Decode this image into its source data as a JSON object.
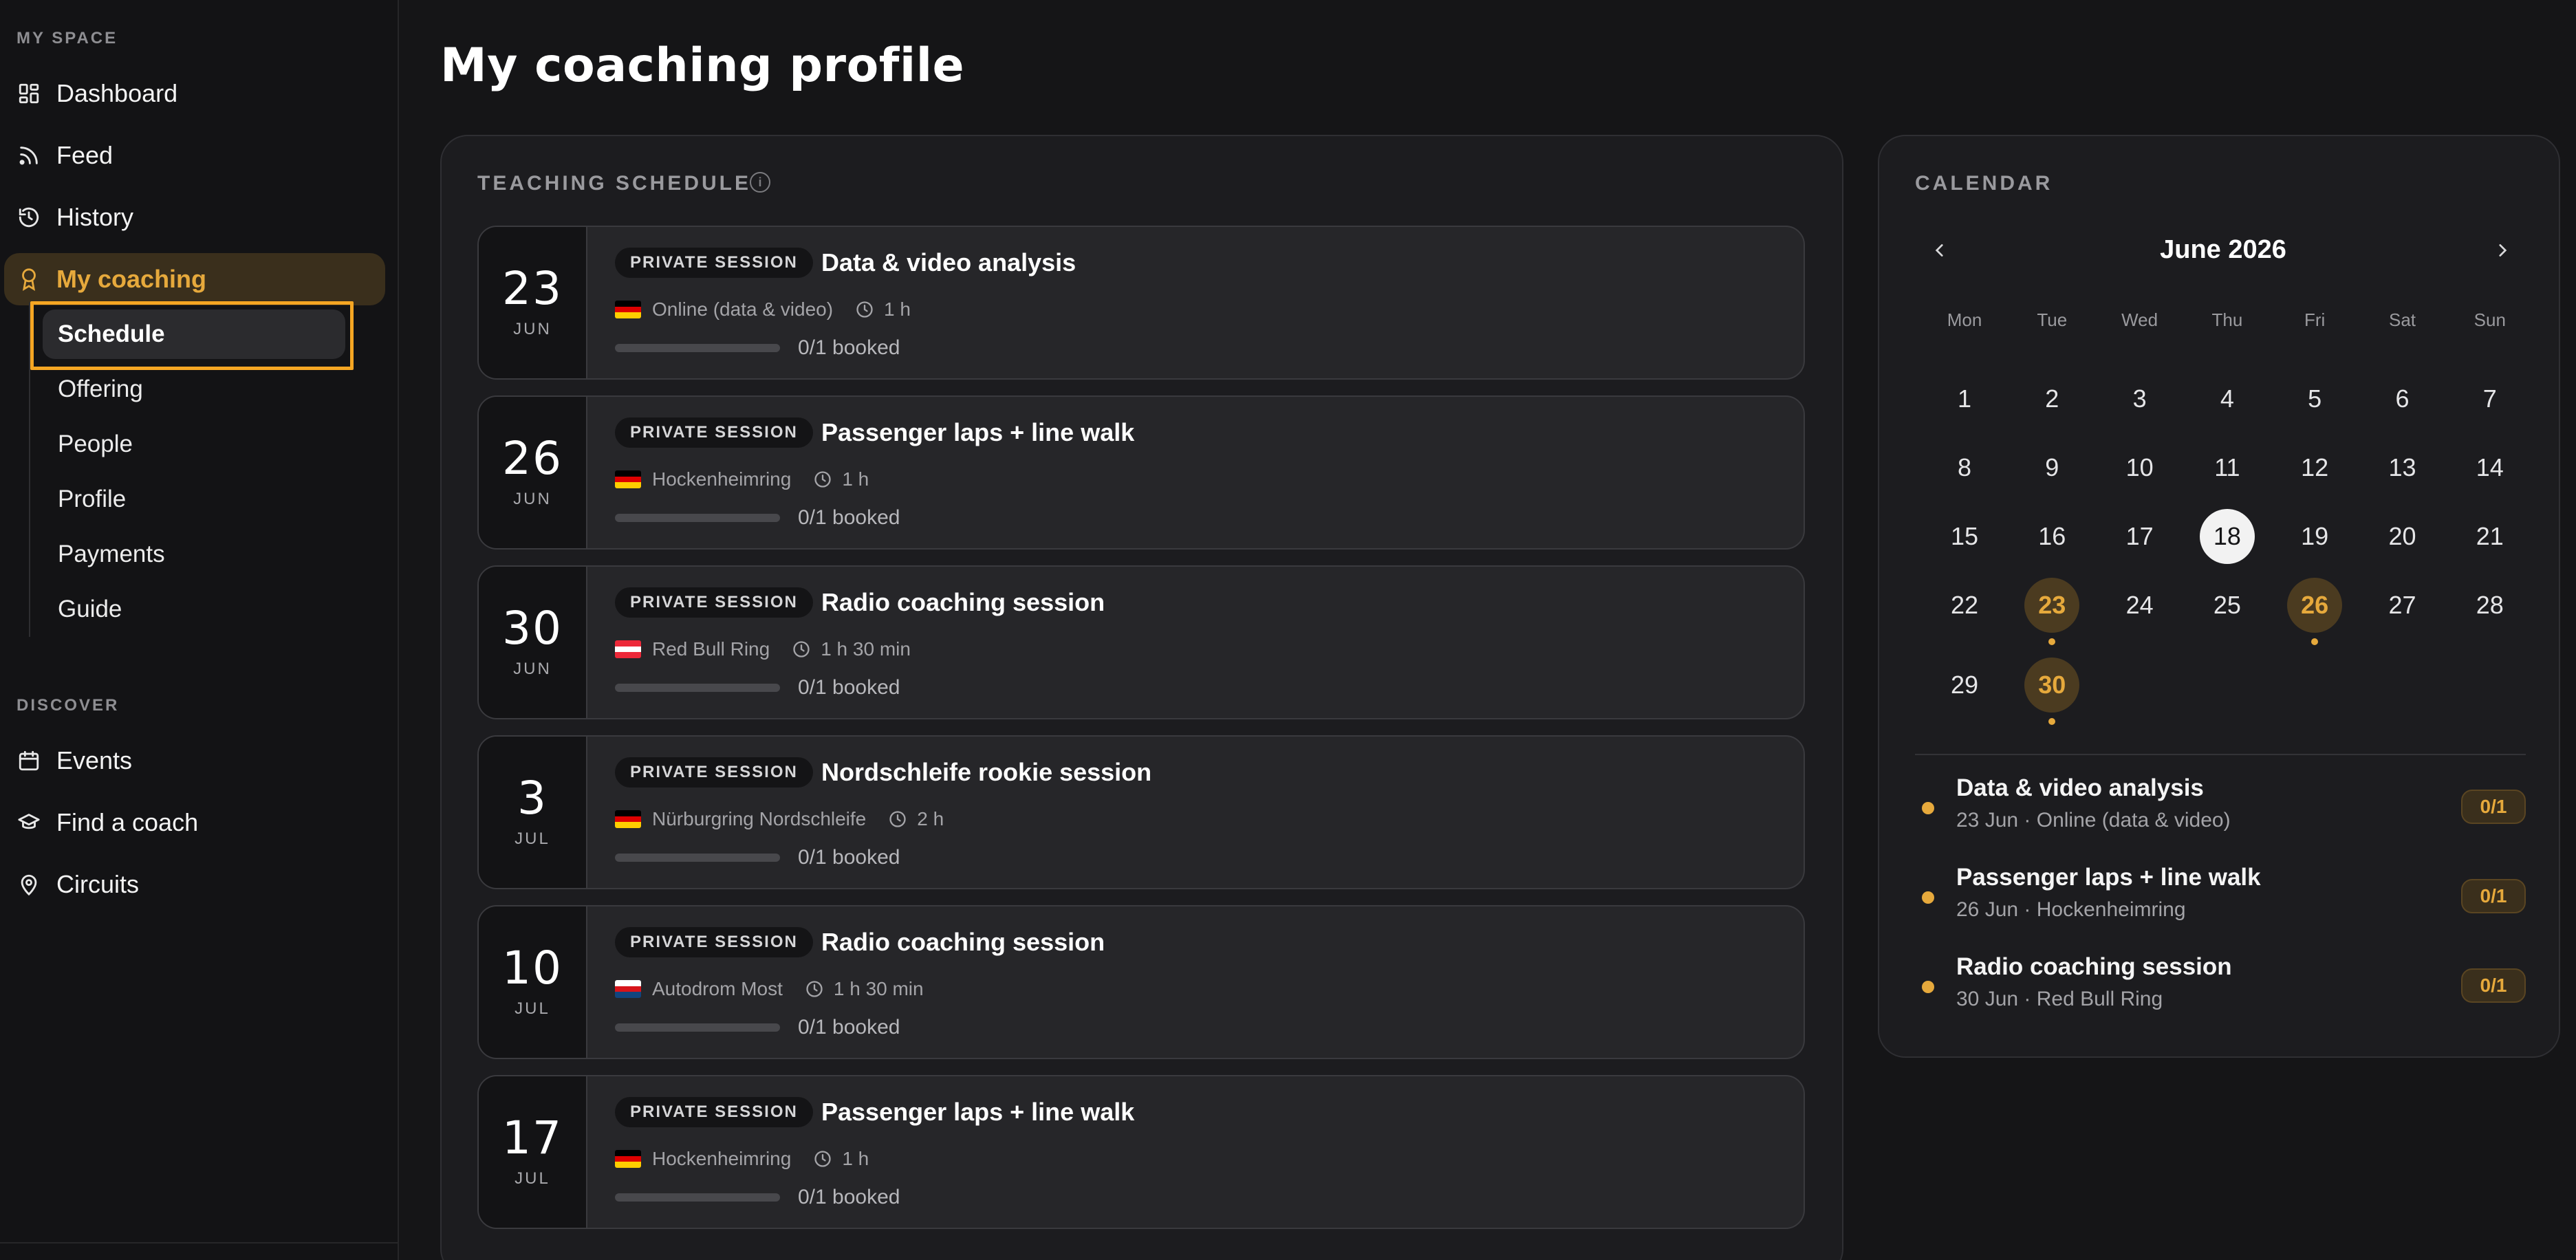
{
  "sidebar": {
    "section_my_space": "MY SPACE",
    "section_discover": "DISCOVER",
    "items": [
      {
        "label": "Dashboard",
        "icon": "grid-icon"
      },
      {
        "label": "Feed",
        "icon": "rss-icon"
      },
      {
        "label": "History",
        "icon": "history-icon"
      },
      {
        "label": "My coaching",
        "icon": "badge-icon"
      }
    ],
    "subitems": [
      {
        "label": "Schedule"
      },
      {
        "label": "Offering"
      },
      {
        "label": "People"
      },
      {
        "label": "Profile"
      },
      {
        "label": "Payments"
      },
      {
        "label": "Guide"
      }
    ],
    "discover_items": [
      {
        "label": "Events",
        "icon": "calendar-icon"
      },
      {
        "label": "Find a coach",
        "icon": "graduation-cap-icon"
      },
      {
        "label": "Circuits",
        "icon": "map-pin-icon"
      }
    ]
  },
  "page": {
    "title": "My coaching profile"
  },
  "schedule": {
    "label": "TEACHING SCHEDULE",
    "sessions": [
      {
        "day": "23",
        "month": "JUN",
        "badge": "PRIVATE SESSION",
        "title": "Data & video analysis",
        "location": "Online (data & video)",
        "duration": "1 h",
        "booked": "0/1 booked",
        "booked_fraction": 0,
        "flag": "de"
      },
      {
        "day": "26",
        "month": "JUN",
        "badge": "PRIVATE SESSION",
        "title": "Passenger laps + line walk",
        "location": "Hockenheimring",
        "duration": "1 h",
        "booked": "0/1 booked",
        "booked_fraction": 0,
        "flag": "de"
      },
      {
        "day": "30",
        "month": "JUN",
        "badge": "PRIVATE SESSION",
        "title": "Radio coaching session",
        "location": "Red Bull Ring",
        "duration": "1 h 30 min",
        "booked": "0/1 booked",
        "booked_fraction": 0,
        "flag": "at"
      },
      {
        "day": "3",
        "month": "JUL",
        "badge": "PRIVATE SESSION",
        "title": "Nordschleife rookie session",
        "location": "Nürburgring Nordschleife",
        "duration": "2 h",
        "booked": "0/1 booked",
        "booked_fraction": 0,
        "flag": "de"
      },
      {
        "day": "10",
        "month": "JUL",
        "badge": "PRIVATE SESSION",
        "title": "Radio coaching session",
        "location": "Autodrom Most",
        "duration": "1 h 30 min",
        "booked": "0/1 booked",
        "booked_fraction": 0,
        "flag": "cz"
      },
      {
        "day": "17",
        "month": "JUL",
        "badge": "PRIVATE SESSION",
        "title": "Passenger laps + line walk",
        "location": "Hockenheimring",
        "duration": "1 h",
        "booked": "0/1 booked",
        "booked_fraction": 0,
        "flag": "de"
      }
    ]
  },
  "calendar": {
    "label": "CALENDAR",
    "month": "June 2026",
    "weekdays": [
      "Mon",
      "Tue",
      "Wed",
      "Thu",
      "Fri",
      "Sat",
      "Sun"
    ],
    "days": [
      "1",
      "2",
      "3",
      "4",
      "5",
      "6",
      "7",
      "8",
      "9",
      "10",
      "11",
      "12",
      "13",
      "14",
      "15",
      "16",
      "17",
      "18",
      "19",
      "20",
      "21",
      "22",
      "23",
      "24",
      "25",
      "26",
      "27",
      "28",
      "29",
      "30"
    ],
    "today": "18",
    "event_days": [
      "23",
      "26",
      "30"
    ],
    "upcoming": [
      {
        "title": "Data & video analysis",
        "sub": "23 Jun · Online (data & video)",
        "badge": "0/1"
      },
      {
        "title": "Passenger laps + line walk",
        "sub": "26 Jun · Hockenheimring",
        "badge": "0/1"
      },
      {
        "title": "Radio coaching session",
        "sub": "30 Jun · Red Bull Ring",
        "badge": "0/1"
      }
    ]
  },
  "colors": {
    "accent": "#e6a93c",
    "highlight": "#f5a623",
    "background": "#151517",
    "flags": {
      "de": [
        "#000000",
        "#dd0000",
        "#ffce00"
      ],
      "at": [
        "#ed2939",
        "#ffffff",
        "#ed2939"
      ],
      "cz": [
        "#ffffff",
        "#d7141a",
        "#11457e"
      ]
    }
  }
}
